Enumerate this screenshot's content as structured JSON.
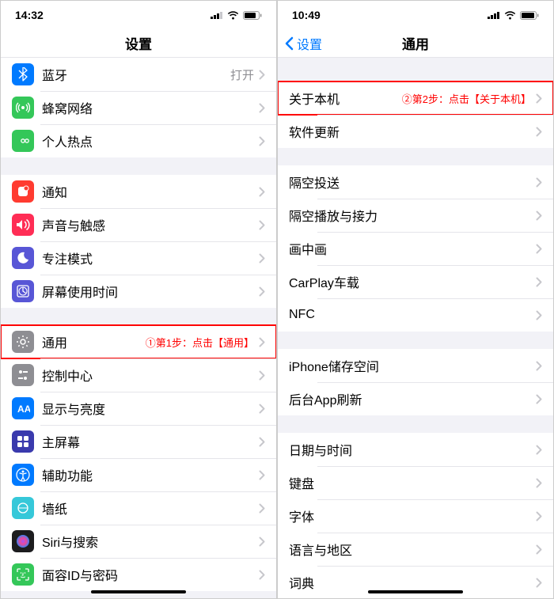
{
  "left": {
    "time": "14:32",
    "title": "设置",
    "group1": [
      {
        "label": "蓝牙",
        "value": "打开",
        "icon_bg": "#007aff",
        "icon_name": "bluetooth-icon"
      },
      {
        "label": "蜂窝网络",
        "value": "",
        "icon_bg": "#34c759",
        "icon_name": "antenna-icon"
      },
      {
        "label": "个人热点",
        "value": "",
        "icon_bg": "#34c759",
        "icon_name": "hotspot-icon"
      }
    ],
    "group2": [
      {
        "label": "通知",
        "icon_bg": "#ff3b30",
        "icon_name": "notifications-icon"
      },
      {
        "label": "声音与触感",
        "icon_bg": "#ff2d55",
        "icon_name": "sounds-icon"
      },
      {
        "label": "专注模式",
        "icon_bg": "#5856d6",
        "icon_name": "focus-icon"
      },
      {
        "label": "屏幕使用时间",
        "icon_bg": "#5856d6",
        "icon_name": "screentime-icon"
      }
    ],
    "group3": [
      {
        "label": "通用",
        "icon_bg": "#8e8e93",
        "icon_name": "general-icon",
        "annotation": "①第1步：点击【通用】",
        "highlight": true
      },
      {
        "label": "控制中心",
        "icon_bg": "#8e8e93",
        "icon_name": "control-center-icon"
      },
      {
        "label": "显示与亮度",
        "icon_bg": "#007aff",
        "icon_name": "display-icon"
      },
      {
        "label": "主屏幕",
        "icon_bg": "#3a3aad",
        "icon_name": "home-screen-icon"
      },
      {
        "label": "辅助功能",
        "icon_bg": "#007aff",
        "icon_name": "accessibility-icon"
      },
      {
        "label": "墙纸",
        "icon_bg": "#36c8d9",
        "icon_name": "wallpaper-icon"
      },
      {
        "label": "Siri与搜索",
        "icon_bg": "#1c1c1e",
        "icon_name": "siri-icon"
      },
      {
        "label": "面容ID与密码",
        "icon_bg": "#34c759",
        "icon_name": "faceid-icon"
      }
    ]
  },
  "right": {
    "time": "10:49",
    "back": "设置",
    "title": "通用",
    "group1": [
      {
        "label": "关于本机",
        "annotation": "②第2步：点击【关于本机】",
        "highlight": true
      },
      {
        "label": "软件更新"
      }
    ],
    "group2": [
      {
        "label": "隔空投送"
      },
      {
        "label": "隔空播放与接力"
      },
      {
        "label": "画中画"
      },
      {
        "label": "CarPlay车载"
      },
      {
        "label": "NFC"
      }
    ],
    "group3": [
      {
        "label": "iPhone储存空间"
      },
      {
        "label": "后台App刷新"
      }
    ],
    "group4": [
      {
        "label": "日期与时间"
      },
      {
        "label": "键盘"
      },
      {
        "label": "字体"
      },
      {
        "label": "语言与地区"
      },
      {
        "label": "词典"
      }
    ]
  }
}
